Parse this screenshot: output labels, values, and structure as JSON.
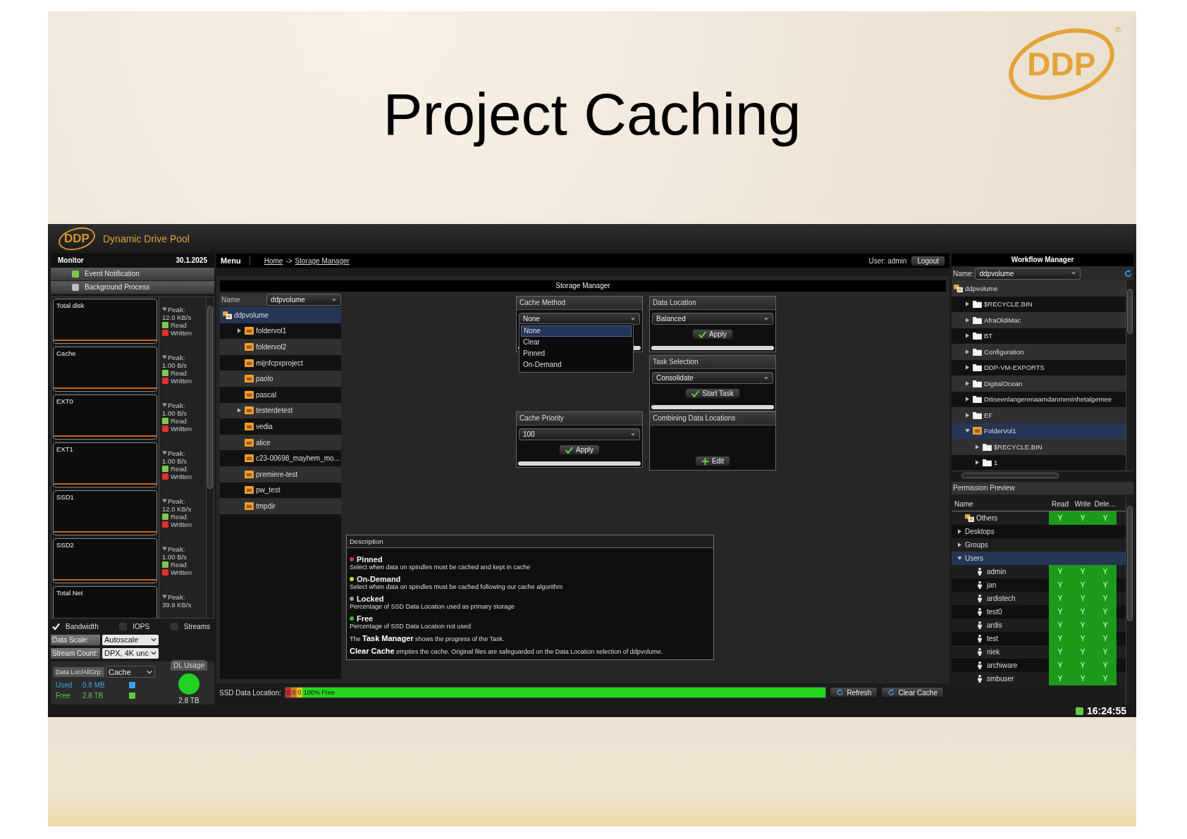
{
  "slide": {
    "title": "Project Caching",
    "logo": "DDP",
    "logo_mark": "®"
  },
  "app": {
    "logo": "DDP",
    "name": "Dynamic Drive Pool",
    "clock": "16:24:55"
  },
  "monitor": {
    "title": "Monitor",
    "date": "30.1.2025",
    "toggles": [
      {
        "label": "Event Notification",
        "on": true
      },
      {
        "label": "Background Process",
        "on": false
      }
    ],
    "graphs": [
      {
        "label": "Total disk",
        "peak_label": "Peak:",
        "peak": "12.0 KB/s",
        "read": "Read",
        "written": "Written"
      },
      {
        "label": "Cache",
        "peak_label": "Peak:",
        "peak": "1.00 B/s",
        "read": "Read",
        "written": "Written"
      },
      {
        "label": "EXT0",
        "peak_label": "Peak:",
        "peak": "1.00 B/s",
        "read": "Read",
        "written": "Written"
      },
      {
        "label": "EXT1",
        "peak_label": "Peak:",
        "peak": "1.00 B/s",
        "read": "Read",
        "written": "Written"
      },
      {
        "label": "SSD1",
        "peak_label": "Peak:",
        "peak": "12.0 KB/s",
        "read": "Read",
        "written": "Written"
      },
      {
        "label": "SSD2",
        "peak_label": "Peak:",
        "peak": "1.00 B/s",
        "read": "Read",
        "written": "Written"
      },
      {
        "label": "Total Net",
        "peak_label": "Peak:",
        "peak": "39.9 KB/s"
      }
    ],
    "metrics": [
      {
        "label": "Bandwidth",
        "checked": true
      },
      {
        "label": "IOPS",
        "checked": false
      },
      {
        "label": "Streams",
        "checked": false
      }
    ],
    "fields": [
      {
        "label": "Data Scale:",
        "value": "Autoscale"
      },
      {
        "label": "Stream Count:",
        "value": "DPX, 4K unc"
      }
    ],
    "dl_usage": {
      "tab": "DL Usage",
      "location_label": "Data Loc/AllGrp:",
      "location": "Cache",
      "total": "2.8 TB",
      "usage": [
        {
          "label": "Used",
          "value": "0.8 MB",
          "color": "#3aa4e8"
        },
        {
          "label": "Free",
          "value": "2.8 TB",
          "color": "#62c848"
        }
      ]
    }
  },
  "nav": {
    "menu": "Menu",
    "breadcrumb": [
      {
        "label": "Home"
      },
      {
        "label": "Storage Manager"
      }
    ],
    "separator": "->",
    "user": "User: admin",
    "logout": "Logout"
  },
  "storage_manager": {
    "title": "Storage Manager",
    "name_label": "Name",
    "name_value": "ddpvolume",
    "tree": [
      {
        "label": "ddpvolume",
        "kind": "volume",
        "selected": true,
        "children": [
          {
            "label": "foldervol1",
            "kind": "pv-folder",
            "selected": false,
            "expanded": false
          },
          {
            "label": "foldervol2",
            "kind": "pv-folder",
            "selected": false
          },
          {
            "label": "mijnfcpxproject",
            "kind": "pv-folder",
            "selected": false
          },
          {
            "label": "paolo",
            "kind": "pv-folder",
            "selected": false
          },
          {
            "label": "pascal",
            "kind": "pv-folder",
            "selected": false
          },
          {
            "label": "testerdetest",
            "kind": "pv-folder",
            "selected": false,
            "expanded": false
          },
          {
            "label": "vedia",
            "kind": "pv-folder",
            "selected": false
          },
          {
            "label": "alice",
            "kind": "pv-folder",
            "selected": false
          },
          {
            "label": "c23-00698_mayhem_mo...",
            "kind": "pv-folder",
            "selected": false
          },
          {
            "label": "premiere-test",
            "kind": "pv-folder",
            "selected": false
          },
          {
            "label": "pw_test",
            "kind": "pv-folder",
            "selected": false
          },
          {
            "label": "tmpdir",
            "kind": "pv-folder",
            "selected": false
          }
        ]
      }
    ],
    "cache_method": {
      "title": "Cache Method",
      "value": "None",
      "options": [
        {
          "label": "None",
          "selected": true
        },
        {
          "label": "Clear",
          "selected": false
        },
        {
          "label": "Pinned",
          "selected": false
        },
        {
          "label": "On-Demand",
          "selected": false
        }
      ]
    },
    "data_location": {
      "title": "Data Location",
      "value": "Balanced",
      "button": "Apply"
    },
    "task_selection": {
      "title": "Task Selection",
      "value": "Consolidate",
      "button": "Start Task"
    },
    "cache_priority": {
      "title": "Cache Priority",
      "value": "100",
      "button": "Apply"
    },
    "combining": {
      "title": "Combining Data Locations",
      "button": "Edit"
    },
    "description": {
      "title": "Description",
      "items": [
        {
          "label": "Pinned",
          "color": "#d03a3a",
          "text": "Select when data on spindles must be cached and kept in cache"
        },
        {
          "label": "On-Demand",
          "color": "#e0d418",
          "text": "Select when data on spindles must be cached following our cache algorithm"
        },
        {
          "label": "Locked",
          "color": "#9a9a9a",
          "text": "Percentage of SSD Data Location used as primary storage"
        },
        {
          "label": "Free",
          "color": "#28c828",
          "text": "Percentage of SSD Data Location not used"
        }
      ],
      "notes": [
        "The **Task Manager** shows the progress of the Task.",
        "**Clear Cache** empties the cache. Original files are safeguarded on the Data Location selection of ddpvolume."
      ]
    },
    "ssd": {
      "label": "SSD Data Location:",
      "segments": [
        {
          "text": "0",
          "color": "#c83030"
        },
        {
          "text": "0",
          "color": "#d87a20"
        },
        {
          "text": "0",
          "color": "#e0c820"
        }
      ],
      "free": "100% Free",
      "level": 1
    },
    "buttons": [
      "Refresh",
      "Clear Cache"
    ]
  },
  "workflow": {
    "title": "Workflow Manager",
    "name_label": "Name:",
    "name_value": "ddpvolume",
    "tree": [
      {
        "label": "ddpvolume",
        "kind": "volume",
        "selected": false,
        "children": [
          {
            "label": "$RECYCLE.BIN",
            "kind": "folder",
            "selected": false,
            "expanded": false
          },
          {
            "label": "AfraOldiMac",
            "kind": "folder",
            "selected": false,
            "expanded": false
          },
          {
            "label": "BT",
            "kind": "folder",
            "selected": false,
            "expanded": false
          },
          {
            "label": "Configuration",
            "kind": "folder",
            "selected": false,
            "expanded": false
          },
          {
            "label": "DDP-VM-EXPORTS",
            "kind": "folder",
            "selected": false,
            "expanded": false
          },
          {
            "label": "DigitalOcean",
            "kind": "folder",
            "selected": false,
            "expanded": false
          },
          {
            "label": "Ditiseenlangerenaamdanmeninhetalgemee",
            "kind": "folder",
            "selected": false,
            "expanded": false
          },
          {
            "label": "EF",
            "kind": "folder",
            "selected": false,
            "expanded": false
          },
          {
            "label": "FolderVol1",
            "kind": "pv-folder",
            "selected": true,
            "expanded": true,
            "children": [
              {
                "label": "$RECYCLE.BIN",
                "kind": "folder",
                "selected": false,
                "expanded": false
              },
              {
                "label": "1",
                "kind": "folder",
                "selected": false,
                "expanded": false
              }
            ]
          }
        ]
      }
    ],
    "permissions": {
      "title": "Permission Preview",
      "columns": [
        "Name",
        "Read",
        "Write",
        "Dele…"
      ],
      "rows": [
        {
          "name": "Others",
          "kind": "group",
          "selected": false,
          "perms": [
            "Y",
            "Y",
            "Y"
          ]
        },
        {
          "name": "Desktops",
          "kind": "category",
          "selected": false,
          "expanded": false
        },
        {
          "name": "Groups",
          "kind": "category",
          "selected": false,
          "expanded": false
        },
        {
          "name": "Users",
          "kind": "category",
          "selected": true,
          "expanded": true,
          "children": [
            {
              "name": "admin",
              "kind": "user",
              "selected": false,
              "perms": [
                "Y",
                "Y",
                "Y"
              ]
            },
            {
              "name": "jan",
              "kind": "user",
              "selected": false,
              "perms": [
                "Y",
                "Y",
                "Y"
              ]
            },
            {
              "name": "ardistech",
              "kind": "user",
              "selected": false,
              "perms": [
                "Y",
                "Y",
                "Y"
              ]
            },
            {
              "name": "test0",
              "kind": "user",
              "selected": false,
              "perms": [
                "Y",
                "Y",
                "Y"
              ]
            },
            {
              "name": "ardis",
              "kind": "user",
              "selected": false,
              "perms": [
                "Y",
                "Y",
                "Y"
              ]
            },
            {
              "name": "test",
              "kind": "user",
              "selected": false,
              "perms": [
                "Y",
                "Y",
                "Y"
              ]
            },
            {
              "name": "niek",
              "kind": "user",
              "selected": false,
              "perms": [
                "Y",
                "Y",
                "Y"
              ]
            },
            {
              "name": "archiware",
              "kind": "user",
              "selected": false,
              "perms": [
                "Y",
                "Y",
                "Y"
              ]
            },
            {
              "name": "smbuser",
              "kind": "user",
              "selected": false,
              "perms": [
                "Y",
                "Y",
                "Y"
              ]
            }
          ]
        }
      ]
    }
  }
}
